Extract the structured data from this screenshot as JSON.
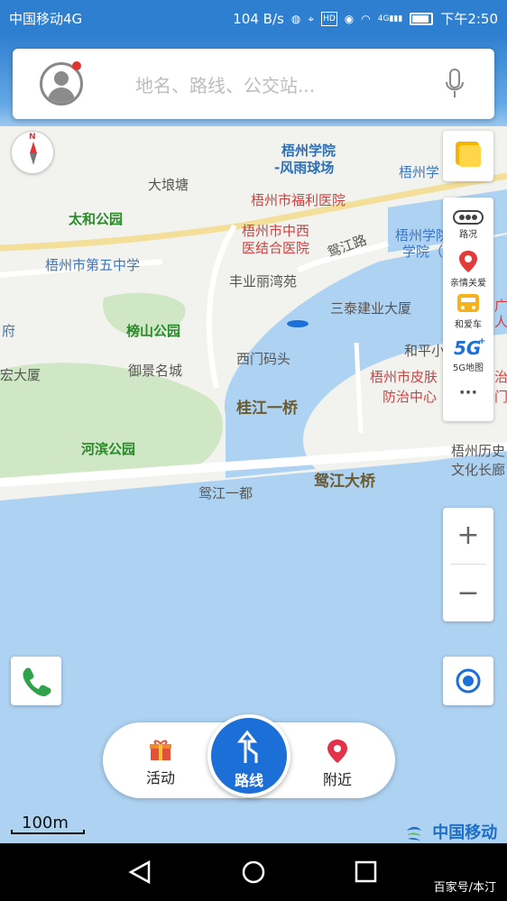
{
  "status_bar": {
    "carrier": "中国移动4G",
    "speed": "104 B/s",
    "time": "下午2:50",
    "hd_badge": "HD",
    "net_badge": "4G"
  },
  "search": {
    "placeholder": "地名、路线、公交站...",
    "avatar_icon": "user-avatar-icon",
    "mic_icon": "microphone-icon"
  },
  "compass": {
    "letter": "N"
  },
  "map_labels": {
    "wuzhou_college_stadium_1": "梧州学院",
    "wuzhou_college_stadium_2": "-风雨球场",
    "wuzhou_college": "梧州学",
    "da_long_tang": "大埌塘",
    "fuli_hospital": "梧州市福利医院",
    "taihe_park": "太和公园",
    "tcm_hospital_1": "梧州市中西",
    "tcm_hospital_2": "医结合医院",
    "wuzhou_college_2": "梧州学院",
    "wuzhou_college_3": "学院（梧",
    "yuan_jiang_road": "鸳江路",
    "no5_middle": "梧州市第五中学",
    "fengyu_liwan": "丰业丽湾苑",
    "santai": "三泰建业大厦",
    "guang": "广",
    "ren": "人",
    "fu": "府",
    "bangshan_park": "榜山公园",
    "ximen_pier": "西门码头",
    "heping": "和平小",
    "hong_building": "宏大厦",
    "yujing": "御景名城",
    "skin_center_1": "梧州市皮肤",
    "skin_center_2": "防治中心",
    "zhi": "治",
    "men": "门",
    "guijiang_bridge": "桂江一桥",
    "hebin_park": "河滨公园",
    "history_1": "梧州历史",
    "history_2": "文化长廊",
    "yuanjiang_bridge": "鸳江大桥",
    "yuanjiang_yidu": "鸳江一都"
  },
  "right_panel": {
    "traffic": "路况",
    "family_care": "亲情关爱",
    "heaiche": "和爱车",
    "map_5g": "5G地图",
    "more": "···"
  },
  "zoom": {
    "plus": "+",
    "minus": "−"
  },
  "bottom_bar": {
    "activity": "活动",
    "route": "路线",
    "nearby": "附近"
  },
  "scale": "100m",
  "brand": "中国移动",
  "watermark": "百家号/本汀",
  "colors": {
    "status_blue": "#2f7fd0",
    "route_blue": "#1d6fd8",
    "water": "#aed2f2",
    "land": "#f2f3ef",
    "park_green": "#cfe7c4",
    "road_yellow": "#f3df9a"
  }
}
